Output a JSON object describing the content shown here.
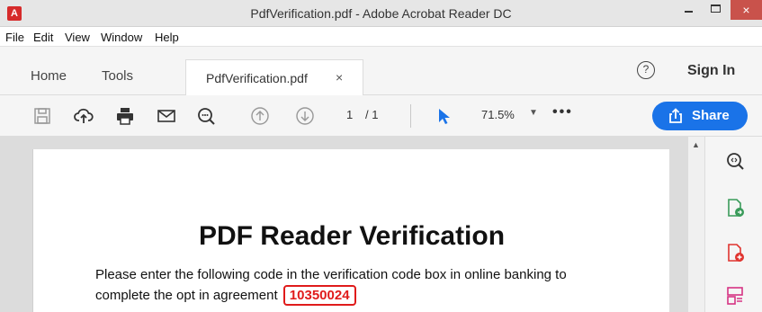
{
  "window": {
    "title": "PdfVerification.pdf - Adobe Acrobat Reader DC",
    "app_icon_glyph": "A",
    "close_glyph": "×"
  },
  "menu": {
    "items": [
      "File",
      "Edit",
      "View",
      "Window",
      "Help"
    ]
  },
  "tabs": {
    "home": "Home",
    "tools": "Tools",
    "document": "PdfVerification.pdf",
    "close_glyph": "×"
  },
  "header": {
    "help_glyph": "?",
    "sign_in": "Sign In"
  },
  "toolbar": {
    "page_current": "1",
    "page_total": "/ 1",
    "zoom": "71.5%",
    "zoom_caret": "▼",
    "more": "•••",
    "share_label": "Share"
  },
  "document": {
    "heading": "PDF Reader Verification",
    "line1": "Please enter the following code in the verification code box in online banking to",
    "line2": "complete the opt in agreement",
    "code": "10350024"
  },
  "colors": {
    "accent": "#1a73e8",
    "highlight": "#e01b1b",
    "close_button": "#c9524b"
  },
  "icons": {
    "toolbar": [
      "save-icon",
      "upload-cloud-icon",
      "print-icon",
      "email-icon",
      "zoom-search-icon",
      "page-up-icon",
      "page-down-icon",
      "select-cursor-icon"
    ],
    "right_panel": [
      "zoom-icon",
      "export-pdf-icon",
      "create-pdf-icon",
      "organize-pages-icon"
    ]
  }
}
